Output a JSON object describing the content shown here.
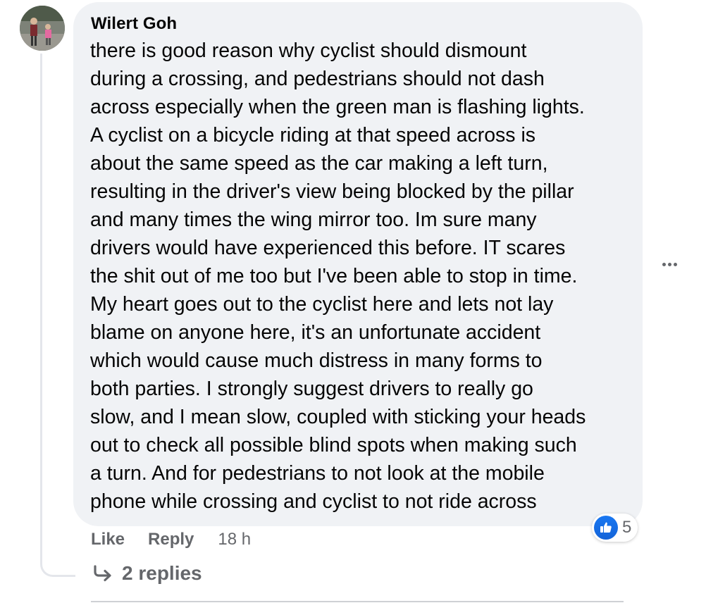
{
  "comment": {
    "author": "Wilert Goh",
    "lines": [
      "there is good reason why cyclist should dismount",
      "during a crossing, and pedestrians should not dash",
      "across especially when the green man is flashing lights.",
      "A cyclist on a bicycle riding at that speed across is",
      "about the same speed as the car making a left turn,",
      "resulting in the driver's view being blocked by the pillar",
      "and many times the wing mirror too. Im sure many",
      "drivers would have experienced this before. IT scares",
      "the shit out of me too but I've been able to stop in time.",
      "My heart goes out to the cyclist here and lets not lay",
      "blame on anyone here, it's an unfortunate accident",
      "which would cause much distress in many forms to",
      "both parties. I strongly suggest drivers to really go",
      "slow, and I mean slow, coupled with sticking your heads",
      "out to check all possible blind spots when making such",
      "a turn. And for pedestrians to not look at the mobile",
      "phone while crossing and cyclist to not ride across"
    ],
    "reaction": {
      "icon": "thumbs-up-icon",
      "count": "5",
      "color": "#1877f2"
    }
  },
  "actions": {
    "like_label": "Like",
    "reply_label": "Reply",
    "timestamp": "18 h"
  },
  "replies": {
    "icon": "reply-arrow-icon",
    "label": "2 replies"
  },
  "colors": {
    "bubble": "#f0f2f5",
    "secondary_text": "#65676b",
    "primary_text": "#050505",
    "thread_line": "#e4e6eb"
  }
}
